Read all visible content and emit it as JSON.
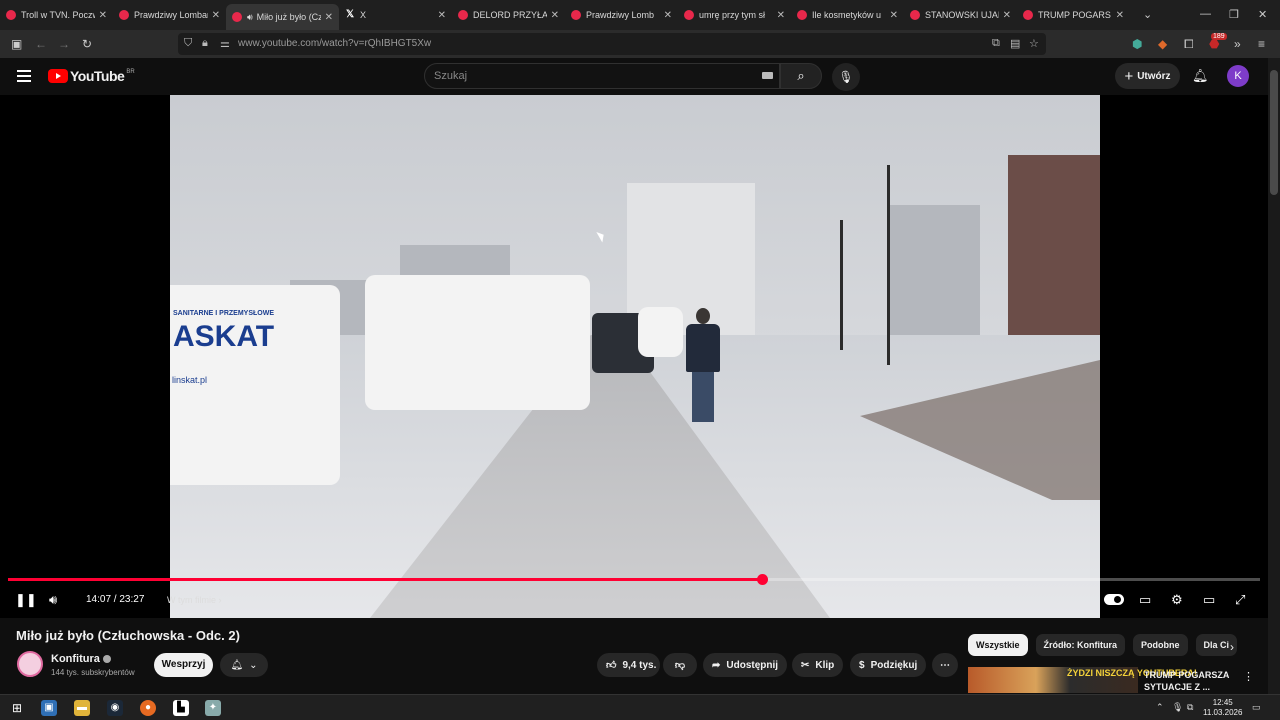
{
  "browser": {
    "tabs": [
      {
        "title": "Troll w TVN. Poczwórn",
        "fav": "yt",
        "active": false
      },
      {
        "title": "Prawdziwy Lombard",
        "fav": "yt",
        "active": false
      },
      {
        "title": "Miło już było (Czł",
        "fav": "yt",
        "active": true,
        "audio": true
      },
      {
        "title": "X",
        "fav": "x",
        "active": false
      },
      {
        "title": "DELORD PRZYŁA",
        "fav": "yt",
        "active": false
      },
      {
        "title": "Prawdziwy Lomb",
        "fav": "yt",
        "active": false
      },
      {
        "title": "umrę przy tym sł",
        "fav": "yt",
        "active": false
      },
      {
        "title": "Ile kosmetyków u",
        "fav": "yt",
        "active": false
      },
      {
        "title": "STANOWSKI UJAI",
        "fav": "yt",
        "active": false
      },
      {
        "title": "TRUMP POGARS",
        "fav": "yt",
        "active": false
      }
    ],
    "url": "www.youtube.com/watch?v=rQhIBHGT5Xw",
    "extension_badge": "189"
  },
  "header": {
    "logo_text": "YouTube",
    "logo_country": "BR",
    "search_placeholder": "Szukaj",
    "create_label": "Utwórz",
    "avatar_letter": "K"
  },
  "player": {
    "time_current": "14:07",
    "time_total": "23:27",
    "progress": 0.602,
    "chapter_label": "W tym filmie",
    "overlay": {
      "van_header": "SANITARNE I PRZEMYSŁOWE",
      "van_logo": "ASKAT",
      "van_url": "linskat.pl"
    }
  },
  "video": {
    "title": "Miło już było (Człuchowska - Odc. 2)",
    "channel": "Konfitura",
    "subscribers": "144 tys. subskrybentów",
    "support_label": "Wesprzyj",
    "likes": "9,4 tys.",
    "share_label": "Udostępnij",
    "clip_label": "Klip",
    "thanks_label": "Podziękuj"
  },
  "sidebar": {
    "chips": [
      "Wszystkie",
      "Źródło: Konfitura",
      "Podobne",
      "Dla Ci"
    ],
    "related": {
      "thumb_text": "ŻYDZI NISZCZĄ YOUTUBERA!",
      "title": "TRUMP POGARSZA SYTUACJE Z ..."
    }
  },
  "taskbar": {
    "time": "12:45",
    "date": "11.03.2026"
  },
  "colors": {
    "accent_red": "#ff0033",
    "avatar_purple": "#7e3cc9",
    "background": "#0f0f0f"
  }
}
